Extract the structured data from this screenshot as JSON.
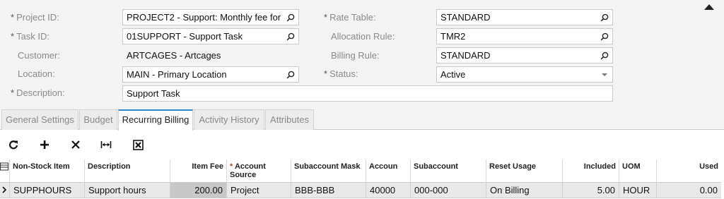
{
  "form": {
    "project_id": {
      "label": "Project ID:",
      "value": "PROJECT2 - Support: Monthly fee for"
    },
    "task_id": {
      "label": "Task ID:",
      "value": "01SUPPORT - Support Task"
    },
    "customer": {
      "label": "Customer:",
      "value": "ARTCAGES - Artcages"
    },
    "location": {
      "label": "Location:",
      "value": "MAIN - Primary Location"
    },
    "description": {
      "label": "Description:",
      "value": "Support Task"
    },
    "rate_table": {
      "label": "Rate Table:",
      "value": "STANDARD"
    },
    "allocation_rule": {
      "label": "Allocation Rule:",
      "value": "TMR2"
    },
    "billing_rule": {
      "label": "Billing Rule:",
      "value": "STANDARD"
    },
    "status": {
      "label": "Status:",
      "value": "Active"
    },
    "required_mark": "*"
  },
  "tabs": [
    "General Settings",
    "Budget",
    "Recurring Billing",
    "Activity History",
    "Attributes"
  ],
  "active_tab": "Recurring Billing",
  "toolbar": {
    "refresh_icon": "refresh-icon",
    "add_icon": "plus-icon",
    "delete_icon": "close-icon",
    "fit_icon": "fit-width-icon",
    "export_icon": "excel-export-icon"
  },
  "grid": {
    "headers": {
      "non_stock_item": "Non-Stock Item",
      "description": "Description",
      "item_fee": "Item Fee",
      "account_source_req": "*",
      "account_source": "Account Source",
      "subaccount_mask": "Subaccount Mask",
      "account": "Accoun",
      "subaccount": "Subaccount",
      "reset_usage": "Reset Usage",
      "included": "Included",
      "uom": "UOM",
      "used": "Used"
    },
    "rows": [
      {
        "non_stock_item": "SUPPHOURS",
        "description": "Support hours",
        "item_fee": "200.00",
        "account_source": "Project",
        "subaccount_mask": "BBB-BBB",
        "account": "40000",
        "subaccount": "000-000",
        "reset_usage": "On Billing",
        "included": "5.00",
        "uom": "HOUR",
        "used": "0.00"
      }
    ]
  },
  "colors": {
    "accent": "#2b83c9",
    "panel": "#f3f3f3"
  }
}
